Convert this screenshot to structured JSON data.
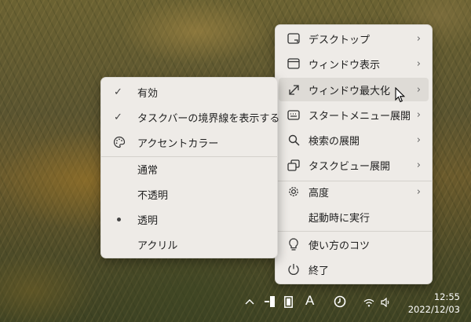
{
  "main_menu": {
    "items": [
      {
        "label": "デスクトップ",
        "icon": "desktop-icon",
        "has_submenu": true
      },
      {
        "label": "ウィンドウ表示",
        "icon": "window-icon",
        "has_submenu": true
      },
      {
        "label": "ウィンドウ最大化",
        "icon": "maximize-icon",
        "has_submenu": true,
        "highlighted": true
      },
      {
        "label": "スタートメニュー展開",
        "icon": "keyboard-icon",
        "has_submenu": true
      },
      {
        "label": "検索の展開",
        "icon": "search-icon",
        "has_submenu": true
      },
      {
        "label": "タスクビュー展開",
        "icon": "task-view-icon",
        "has_submenu": true
      },
      {
        "label": "高度",
        "icon": "gear-icon",
        "has_submenu": true
      },
      {
        "label": "起動時に実行",
        "icon": "",
        "has_submenu": false
      },
      {
        "label": "使い方のコツ",
        "icon": "lightbulb-icon",
        "has_submenu": false
      },
      {
        "label": "終了",
        "icon": "power-icon",
        "has_submenu": false
      }
    ]
  },
  "submenu": {
    "items": [
      {
        "label": "有効",
        "checked": true
      },
      {
        "label": "タスクバーの境界線を表示する",
        "checked": true
      },
      {
        "label": "アクセントカラー",
        "icon": "palette-icon"
      },
      {
        "label": "通常"
      },
      {
        "label": "不透明"
      },
      {
        "label": "透明",
        "selected": true
      },
      {
        "label": "アクリル"
      }
    ]
  },
  "taskbar": {
    "tray_icons": [
      "chevron-up-icon",
      "translucenttb-icon",
      "display-icon",
      "font-a-icon",
      "clock-app-icon",
      "wifi-icon",
      "speaker-icon"
    ],
    "font_glyph": "A",
    "time": "12:55",
    "date": "2022/12/03"
  },
  "colors": {
    "menu_bg": "#eeebe7",
    "hover_bg": "#dedbd6",
    "text": "#1f1f1f"
  }
}
